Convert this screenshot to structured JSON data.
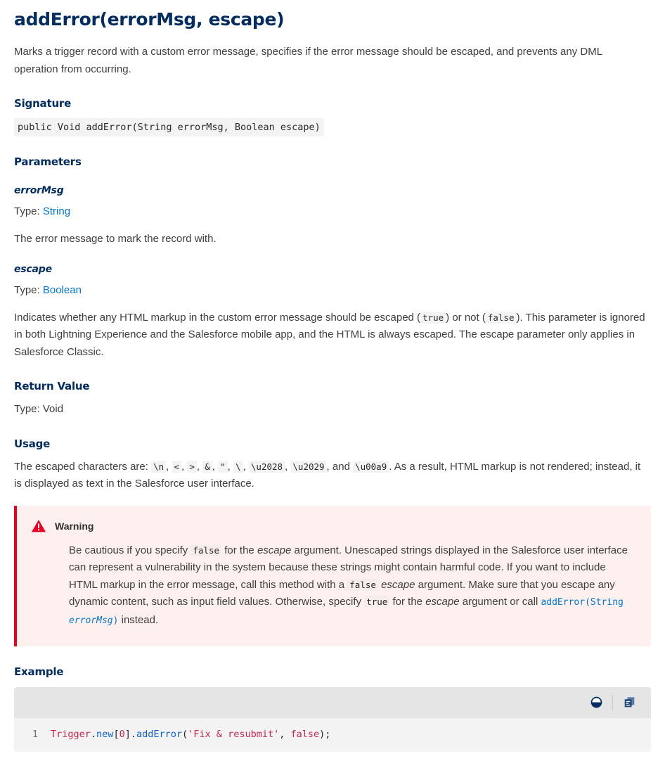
{
  "title": "addError(errorMsg, escape)",
  "intro": "Marks a trigger record with a custom error message, specifies if the error message should be escaped, and prevents any DML operation from occurring.",
  "sections": {
    "signature": {
      "heading": "Signature",
      "code": "public Void addError(String errorMsg, Boolean escape)"
    },
    "parameters": {
      "heading": "Parameters",
      "items": [
        {
          "name": "errorMsg",
          "type_label": "Type:",
          "type_link": "String",
          "description": "The error message to mark the record with."
        },
        {
          "name": "escape",
          "type_label": "Type:",
          "type_link": "Boolean",
          "desc_part1": "Indicates whether any HTML markup in the custom error message should be escaped (",
          "desc_code1": "true",
          "desc_part2": ") or not (",
          "desc_code2": "false",
          "desc_part3": "). This parameter is ignored in both Lightning Experience and the Salesforce mobile app, and the HTML is always escaped. The escape parameter only applies in Salesforce Classic."
        }
      ]
    },
    "return_value": {
      "heading": "Return Value",
      "text": "Type: Void"
    },
    "usage": {
      "heading": "Usage",
      "text_start": "The escaped characters are:",
      "escaped_chars": [
        "\\n",
        "<",
        ">",
        "&",
        "\"",
        "\\",
        "\\u2028",
        "\\u2029"
      ],
      "conjunction": "and",
      "last_char": "\\u00a9",
      "text_end": ". As a result, HTML markup is not rendered; instead, it is displayed as text in the Salesforce user interface."
    },
    "warning": {
      "label": "Warning",
      "icon": "warning-triangle-icon",
      "accent_color": "#ea001e",
      "background_color": "#fdf0ef",
      "p1": "Be cautious if you specify ",
      "code1": "false",
      "p2": " for the ",
      "em1": "escape",
      "p3": " argument. Unescaped strings displayed in the Salesforce user interface can represent a vulnerability in the system because these strings might contain harmful code. If you want to include HTML markup in the error message, call this method with a ",
      "code2": "false",
      "p4": " ",
      "em2": "escape",
      "p5": " argument. Make sure that you escape any dynamic content, such as input field values. Otherwise, specify ",
      "code3": "true",
      "p6": " for the ",
      "em3": "escape",
      "p7": " argument or call ",
      "link_text_a": "addError(String ",
      "link_text_b": "errorMsg",
      "link_text_c": ")",
      "p8": " instead."
    },
    "example": {
      "heading": "Example",
      "toolbar": {
        "contrast_icon": "contrast-toggle-icon",
        "copy_icon": "copy-icon"
      },
      "lines": [
        {
          "number": "1",
          "tokens": [
            {
              "text": "Trigger",
              "type": "class"
            },
            {
              "text": ".",
              "type": "punct"
            },
            {
              "text": "new",
              "type": "prop"
            },
            {
              "text": "[",
              "type": "punct"
            },
            {
              "text": "0",
              "type": "num"
            },
            {
              "text": "]",
              "type": "punct"
            },
            {
              "text": ".",
              "type": "punct"
            },
            {
              "text": "addError",
              "type": "method"
            },
            {
              "text": "(",
              "type": "punct"
            },
            {
              "text": "'Fix & resubmit'",
              "type": "string"
            },
            {
              "text": ", ",
              "type": "punct"
            },
            {
              "text": "false",
              "type": "bool"
            },
            {
              "text": ");",
              "type": "punct"
            }
          ]
        }
      ]
    }
  },
  "colors": {
    "heading": "#032d60",
    "link": "#0176d3",
    "body": "#3e3e3c",
    "warning_red": "#ea001e",
    "code_bg": "#f3f3f3",
    "toolbar_bg": "#e5e5e5"
  }
}
